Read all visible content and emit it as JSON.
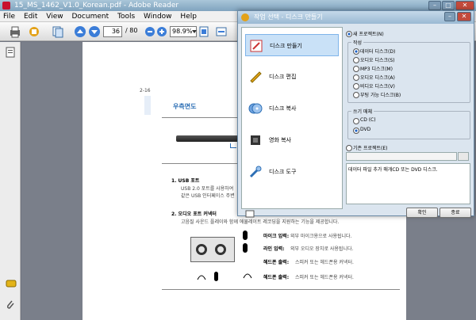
{
  "window": {
    "title": "15_MS_1462_V1.0_Korean.pdf - Adobe Reader"
  },
  "menu": [
    "File",
    "Edit",
    "View",
    "Document",
    "Tools",
    "Window",
    "Help"
  ],
  "toolbar": {
    "page_current": "36",
    "page_total": "/ 80",
    "zoom": "98.9%"
  },
  "page": {
    "page_number": "2-16",
    "section_title": "우측면도",
    "item1_title": "1.  USB 포트",
    "item1_line1": "USB 2.0 포트를 사용하여",
    "item1_line2": "같은 USB 인터페이스 주변",
    "item2_title": "2.  오디오 포트 커넥터",
    "item2_line1": "고음질 사운드 플레이와 함께 에뮬레이트 레코딩을 지원하는 기능을 제공합니다.",
    "mic_label": "마이크 입력:",
    "mic_desc": "외부 마이크용으로 사용됩니다.",
    "line_label": "라인 입력:",
    "line_desc": "외부 오디오 장치로 사용됩니다.",
    "headphone_label": "헤드폰 출력:",
    "headphone_desc": "스피커 또는 헤드폰용 커넥터.",
    "headphone2_label": "헤드폰 출력:",
    "headphone2_desc": "스피커 또는 헤드폰용 커넥터."
  },
  "dialog": {
    "title": "작업 선택 - 디스크 만들기",
    "side_items": [
      {
        "label": "디스크 만들기"
      },
      {
        "label": "디스크 편집"
      },
      {
        "label": "디스크 복사"
      },
      {
        "label": "영화 복사"
      },
      {
        "label": "디스크 도구"
      }
    ],
    "new_project": "새 프로젝트(N)",
    "make_group": "작성",
    "make_options": [
      {
        "label": "데이터 디스크(D)",
        "selected": true
      },
      {
        "label": "오디오 디스크(S)",
        "selected": false
      },
      {
        "label": "MP3 디스크(M)",
        "selected": false
      },
      {
        "label": "오디오 디스크(A)",
        "selected": false
      },
      {
        "label": "비디오 디스크(V)",
        "selected": false
      },
      {
        "label": "부팅 가능 디스크(B)",
        "selected": false
      }
    ],
    "write_group": "쓰기 매체",
    "write_options": [
      {
        "label": "CD (C)",
        "selected": false
      },
      {
        "label": "DVD",
        "selected": true
      }
    ],
    "existing_project": "기존 프로젝트(E)",
    "description": "데이터 파일 추가 매개CD 또는 DVD 디스크.",
    "ok_label": "확인",
    "exit_label": "종료"
  },
  "colors": {
    "accent": "#1f63c6",
    "pdf_red": "#c8102e"
  }
}
